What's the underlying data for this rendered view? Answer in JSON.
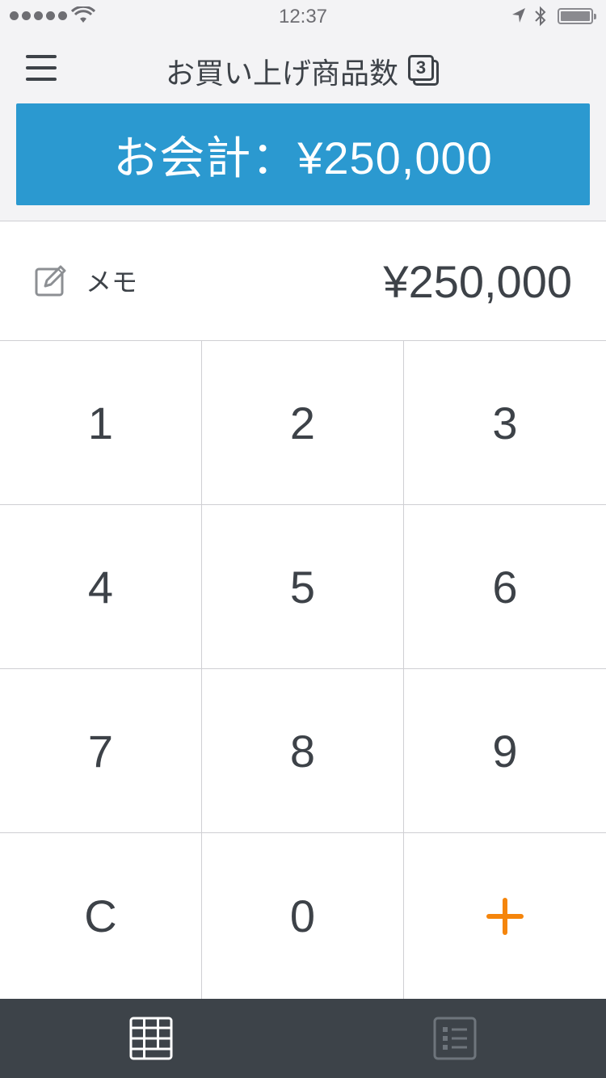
{
  "status_bar": {
    "time": "12:37",
    "signal_dots": 5,
    "battery_level": 1.0,
    "icons": [
      "signal-dots",
      "wifi",
      "location-arrow",
      "bluetooth",
      "battery"
    ]
  },
  "header": {
    "menu_icon": "hamburger-menu",
    "title": "お買い上げ商品数",
    "item_count": "3",
    "checkout_label": "お会計：¥250,000"
  },
  "entry": {
    "memo_icon": "pencil-square",
    "memo_label": "メモ",
    "amount": "¥250,000"
  },
  "keypad": {
    "keys": [
      "1",
      "2",
      "3",
      "4",
      "5",
      "6",
      "7",
      "8",
      "9",
      "C",
      "0"
    ],
    "add_icon": "plus",
    "add_color": "#f5850b"
  },
  "tabs": [
    {
      "icon": "keypad-grid",
      "active": true
    },
    {
      "icon": "item-list",
      "active": false
    }
  ],
  "colors": {
    "accent": "#2b99d0",
    "text": "#3d4248",
    "tab_bar": "#3d4349",
    "header_bg": "#f3f3f5"
  }
}
